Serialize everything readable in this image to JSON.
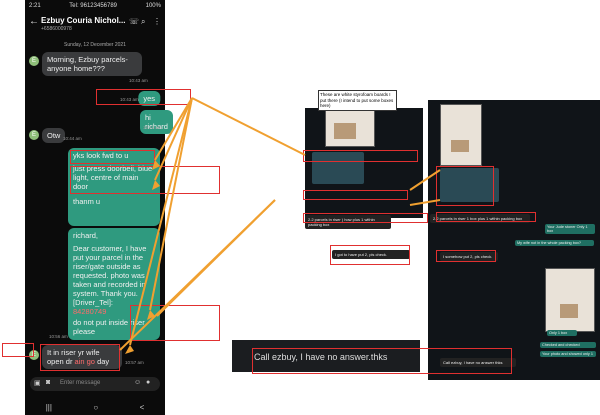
{
  "phone": {
    "status_time": "2:21",
    "status_right": "100%",
    "status_mid": "Tel: 96123456789",
    "title": "Ezbuy Couria Nichol...",
    "subtitle": "+6586000978",
    "date": "Sunday, 12 December 2021",
    "avatar_letter": "E",
    "messages": [
      {
        "text": "Morning, Ezbuy parcels-anyone home???",
        "time": "10:43 am"
      },
      {
        "text": "yes",
        "time": "10:43 am"
      },
      {
        "text": "hi richard",
        "time": "10:44 am"
      },
      {
        "text": "Otw",
        "time": "10:44 am"
      },
      {
        "text": "yks  look fwd to u",
        "time": ""
      },
      {
        "text": "just press doorbell, blue light, centre of main door",
        "time": ""
      },
      {
        "text": "thanm u",
        "time": ""
      },
      {
        "text": "richard,",
        "time": ""
      },
      {
        "text": "Dear customer, I have put your parcel in the riser/gate outside as requested. photo was taken and recorded in system. Thank you. [Driver_Tel]:",
        "time": ""
      },
      {
        "text": "84280749",
        "time": ""
      },
      {
        "text": "do not put inside riser please",
        "time": "10:56 am"
      },
      {
        "text": "It in riser yr wife open dr",
        "time": ""
      },
      {
        "text": "ain go",
        "time": ""
      },
      {
        "text": "day",
        "time": "10:57 am"
      }
    ],
    "input_placeholder": "Enter message",
    "nav": [
      "|||",
      "○",
      "<"
    ]
  },
  "annotations": {
    "note": "These are white styrofoam boards I put there (I intend to put some boxes here)",
    "texts_left": [
      "2.2 parcels in riser ) how plus 1 within packing box",
      "It is in riser 2 pcs in black wet tv lip",
      "parcels will help you",
      "I got to have put 2, pls check.",
      "Call ezbuy, I have no answer.thks"
    ],
    "texts_right": [
      "2.2 parcels in riser 1 box plus 1 within packing box",
      "Your Jude stoner Only 1 box",
      "My wife not in the whole packing box?",
      "I somehow put 2, pls check.",
      "Only 1 box",
      "Checked and checked",
      "Your photo and showed only 1",
      "Call ezbuy, I have no answer thks"
    ]
  },
  "colors": {
    "incoming": "#3a3b3d",
    "outgoing": "#2f9a7f",
    "annotation": "#e03030",
    "arrow": "#f0a030"
  }
}
